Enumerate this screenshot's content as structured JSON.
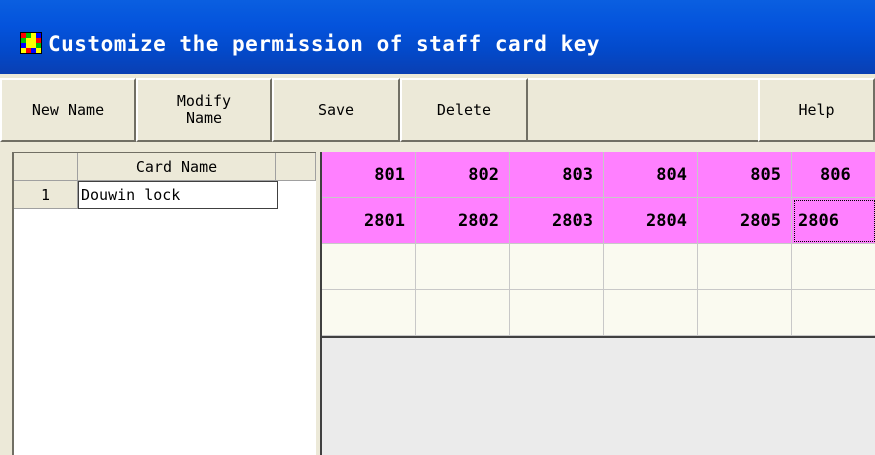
{
  "window": {
    "title": "Customize the permission of staff card key",
    "icon": "app-icon"
  },
  "toolbar": {
    "new_name": "New Name",
    "modify_name_line1": "Modify",
    "modify_name_line2": "Name",
    "save": "Save",
    "delete": "Delete",
    "help": "Help"
  },
  "card_list": {
    "header": "Card Name",
    "rows": [
      {
        "index": "1",
        "name": "Douwin lock"
      }
    ]
  },
  "permission_grid": {
    "row1": [
      "801",
      "802",
      "803",
      "804",
      "805",
      "806"
    ],
    "row2": [
      "2801",
      "2802",
      "2803",
      "2804",
      "2805",
      "2806"
    ]
  },
  "colors": {
    "title_bar": "#0453dc",
    "selected_cells": "#ff80ff",
    "empty_cells": "#fafaf0",
    "face": "#ece9d8"
  }
}
